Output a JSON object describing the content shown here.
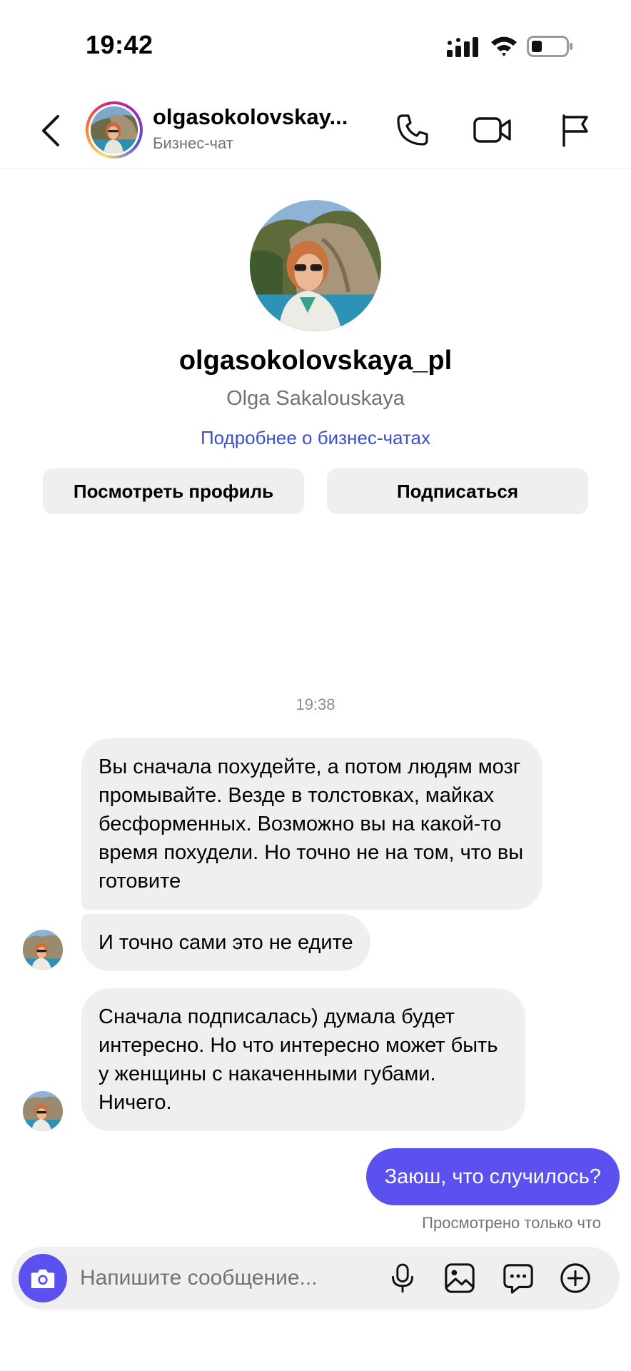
{
  "status_bar": {
    "time": "19:42"
  },
  "header": {
    "username": "olgasokolovskay...",
    "subtitle": "Бизнес-чат"
  },
  "profile": {
    "username": "olgasokolovskaya_pl",
    "full_name": "Olga Sakalouskaya",
    "business_link": "Подробнее о бизнес-чатах",
    "view_profile_label": "Посмотреть профиль",
    "follow_label": "Подписаться"
  },
  "chat": {
    "timestamp": "19:38",
    "messages": [
      {
        "direction": "in",
        "text": "Вы сначала похудейте, а потом людям мозг промывайте. Везде в толстовках, майках бесформенных. Возможно вы на какой-то время похудели. Но точно не на том, что вы готовите"
      },
      {
        "direction": "in",
        "text": "И точно сами это не едите"
      },
      {
        "direction": "in",
        "text": "Сначала подписалась) думала будет интересно.  Но что интересно может быть у женщины с накаченными губами. Ничего."
      },
      {
        "direction": "out",
        "text": "Заюш, что случилось?"
      }
    ],
    "seen_status": "Просмотрено только что"
  },
  "composer": {
    "placeholder": "Напишите сообщение..."
  },
  "colors": {
    "accent": "#5b51f0",
    "link": "#3d4ec9",
    "bubble_in": "#efefef",
    "secondary_text": "#737373"
  },
  "icons": {
    "header": [
      "back-arrow-icon",
      "phone-icon",
      "video-camera-icon",
      "flag-icon"
    ],
    "composer": [
      "camera-icon",
      "microphone-icon",
      "image-icon",
      "sticker-chat-icon",
      "plus-circle-icon"
    ]
  }
}
